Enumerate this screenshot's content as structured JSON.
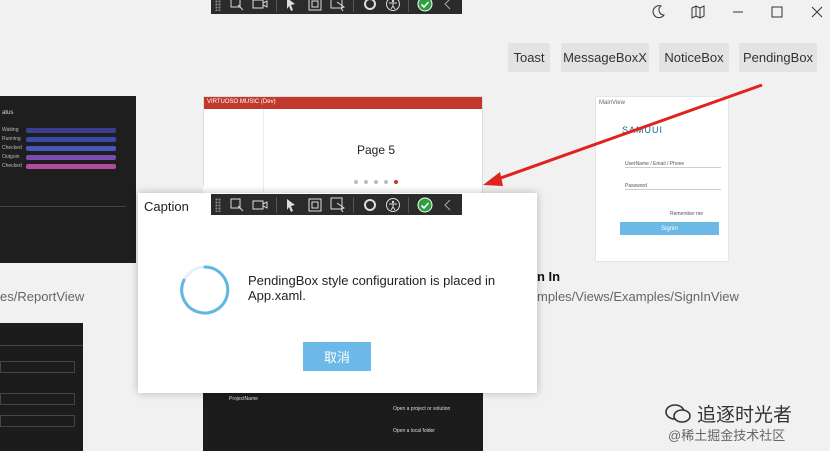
{
  "tabs": [
    "Toast",
    "MessageBoxX",
    "NoticeBox",
    "PendingBox"
  ],
  "background": {
    "report_card_title": "atus",
    "report_rows": [
      "Waiting",
      "Running",
      "Checked",
      "Outgoin",
      "Checked"
    ],
    "page_card_header": "VIRTUOSO MUSIC (Dev)",
    "page_label": "Page 5",
    "signin_card_title": "MainView",
    "signin_logo": "SAMUUI",
    "signin_fields": [
      "UserName / Email / Phone",
      "Password"
    ],
    "signin_remember": "Remember me",
    "signin_button": "Signin",
    "label_reportview": "es/ReportView",
    "label_signin_title": "n In",
    "label_signinview": "mples/Views/Examples/SignInView",
    "bottom_card_lines": [
      "ProjectName",
      "Open a project or solution",
      "Open a local folder"
    ]
  },
  "modal": {
    "caption": "Caption",
    "message": "PendingBox style configuration is placed in App.xaml.",
    "cancel_label": "取消"
  },
  "watermark": {
    "name": "追逐时光者",
    "site": "@稀土掘金技术社区"
  }
}
